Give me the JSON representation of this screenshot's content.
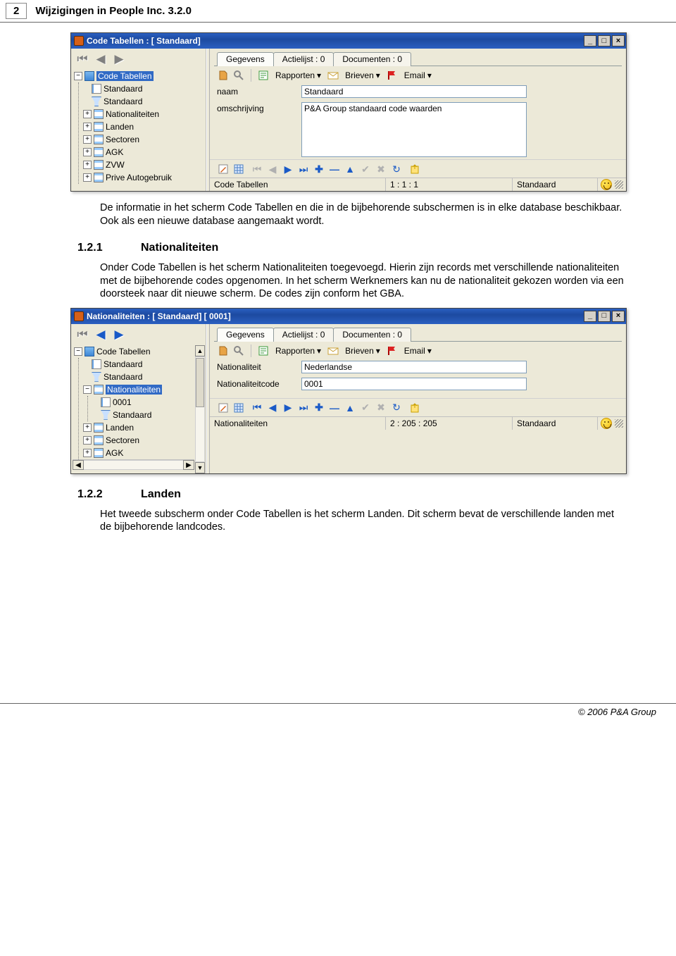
{
  "page": {
    "number": "2",
    "title": "Wijzigingen in People Inc. 3.2.0"
  },
  "intro_para": "De informatie in het scherm Code Tabellen en die in de bijbehorende subschermen is in elke database beschikbaar. Ook als een nieuwe database aangemaakt wordt.",
  "sec121": {
    "num": "1.2.1",
    "title": "Nationaliteiten",
    "body": "Onder Code Tabellen is het scherm Nationaliteiten toegevoegd. Hierin zijn records met verschillende nationaliteiten met de bijbehorende codes opgenomen. In het scherm Werknemers kan nu de nationaliteit gekozen worden via een doorsteek naar dit nieuwe scherm. De codes zijn conform het GBA."
  },
  "sec122": {
    "num": "1.2.2",
    "title": "Landen",
    "body": "Het tweede subscherm onder Code Tabellen is het scherm Landen. Dit scherm bevat de verschillende landen met de bijbehorende landcodes."
  },
  "shot1": {
    "title": "Code Tabellen : [ Standaard]",
    "tree": {
      "root": "Code Tabellen",
      "items": [
        "Standaard",
        "Standaard",
        "Nationaliteiten",
        "Landen",
        "Sectoren",
        "AGK",
        "ZVW",
        "Prive Autogebruik"
      ]
    },
    "tabs": {
      "gegevens": "Gegevens",
      "actielijst": "Actielijst : 0",
      "documenten": "Documenten : 0"
    },
    "toolbar": {
      "rapporten": "Rapporten",
      "brieven": "Brieven",
      "email": "Email"
    },
    "form": {
      "naam_label": "naam",
      "naam": "Standaard",
      "oms_label": "omschrijving",
      "oms": "P&A Group standaard code waarden"
    },
    "status": {
      "left": "Code Tabellen",
      "mid": "1 : 1 : 1",
      "right": "Standaard"
    }
  },
  "shot2": {
    "title": "Nationaliteiten : [ Standaard] [ 0001]",
    "tree": {
      "root": "Code Tabellen",
      "items_top": [
        "Standaard",
        "Standaard"
      ],
      "nat": "Nationaliteiten",
      "nat_children": [
        "0001",
        "Standaard"
      ],
      "items_bottom": [
        "Landen",
        "Sectoren",
        "AGK"
      ]
    },
    "tabs": {
      "gegevens": "Gegevens",
      "actielijst": "Actielijst : 0",
      "documenten": "Documenten : 0"
    },
    "toolbar": {
      "rapporten": "Rapporten",
      "brieven": "Brieven",
      "email": "Email"
    },
    "form": {
      "nat_label": "Nationaliteit",
      "nat": "Nederlandse",
      "code_label": "Nationaliteitcode",
      "code": "0001"
    },
    "status": {
      "left": "Nationaliteiten",
      "mid": "2 : 205 : 205",
      "right": "Standaard"
    }
  },
  "footer": "© 2006 P&A Group"
}
